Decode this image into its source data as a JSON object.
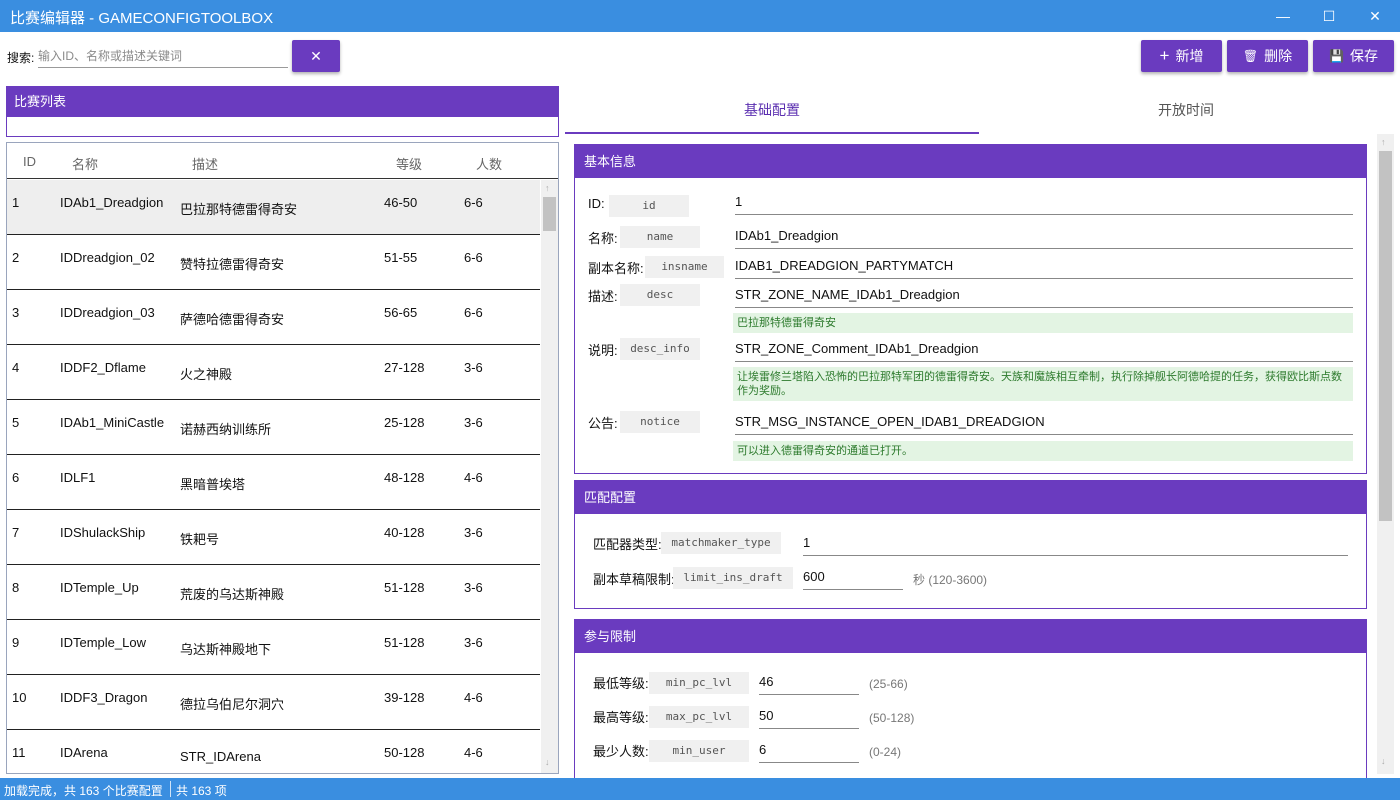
{
  "window": {
    "title": "比赛编辑器 - GAMECONFIGTOOLBOX",
    "minimize_icon": "minimize-icon",
    "maximize_icon": "maximize-icon",
    "close_icon": "close-icon",
    "minimize_glyph": "—",
    "maximize_glyph": "☐",
    "close_glyph": "✕"
  },
  "toolbar": {
    "search_label": "搜索:",
    "search_placeholder": "输入ID、名称或描述关键词",
    "search_value": "",
    "clear_glyph": "✕",
    "add_glyph": "+",
    "add_label": "新增",
    "delete_glyph": "🗑",
    "delete_label": "删除",
    "save_glyph": "💾",
    "save_label": "保存"
  },
  "list": {
    "header": "比赛列表",
    "columns": [
      "ID",
      "名称",
      "描述",
      "等级",
      "人数"
    ],
    "rows": [
      {
        "id": "1",
        "name": "IDAb1_Dreadgion",
        "desc": "巴拉那特德雷得奇安",
        "level": "46-50",
        "count": "6-6",
        "selected": true
      },
      {
        "id": "2",
        "name": "IDDreadgion_02",
        "desc": "赞特拉德雷得奇安",
        "level": "51-55",
        "count": "6-6"
      },
      {
        "id": "3",
        "name": "IDDreadgion_03",
        "desc": "萨德哈德雷得奇安",
        "level": "56-65",
        "count": "6-6"
      },
      {
        "id": "4",
        "name": "IDDF2_Dflame",
        "desc": "火之神殿",
        "level": "27-128",
        "count": "3-6"
      },
      {
        "id": "5",
        "name": "IDAb1_MiniCastle",
        "desc": "诺赫西纳训练所",
        "level": "25-128",
        "count": "3-6"
      },
      {
        "id": "6",
        "name": "IDLF1",
        "desc": "黑暗普埃塔",
        "level": "48-128",
        "count": "4-6"
      },
      {
        "id": "7",
        "name": "IDShulackShip",
        "desc": "铁耙号",
        "level": "40-128",
        "count": "3-6"
      },
      {
        "id": "8",
        "name": "IDTemple_Up",
        "desc": "荒废的乌达斯神殿",
        "level": "51-128",
        "count": "3-6"
      },
      {
        "id": "9",
        "name": "IDTemple_Low",
        "desc": "乌达斯神殿地下",
        "level": "51-128",
        "count": "3-6"
      },
      {
        "id": "10",
        "name": "IDDF3_Dragon",
        "desc": "德拉乌伯尼尔洞穴",
        "level": "39-128",
        "count": "4-6"
      },
      {
        "id": "11",
        "name": "IDArena",
        "desc": "STR_IDArena",
        "level": "50-128",
        "count": "4-6"
      }
    ]
  },
  "tabs": [
    {
      "label": "基础配置",
      "active": true
    },
    {
      "label": "开放时间",
      "active": false
    }
  ],
  "basic_info": {
    "header": "基本信息",
    "fields": [
      {
        "label": "ID:",
        "key": "id",
        "value": "1"
      },
      {
        "label": "名称:",
        "key": "name",
        "value": "IDAb1_Dreadgion"
      },
      {
        "label": "副本名称:",
        "key": "insname",
        "value": "IDAB1_DREADGION_PARTYMATCH"
      },
      {
        "label": "描述:",
        "key": "desc",
        "value": "STR_ZONE_NAME_IDAb1_Dreadgion",
        "note": "巴拉那特德雷得奇安"
      },
      {
        "label": "说明:",
        "key": "desc_info",
        "value": "STR_ZONE_Comment_IDAb1_Dreadgion",
        "note": "让埃雷修兰塔陷入恐怖的巴拉那特军团的德雷得奇安。天族和魔族相互牵制，执行除掉舰长阿德哈提的任务，获得欧比斯点数作为奖励。"
      },
      {
        "label": "公告:",
        "key": "notice",
        "value": "STR_MSG_INSTANCE_OPEN_IDAB1_DREADGION",
        "note": "可以进入德雷得奇安的通道已打开。"
      }
    ]
  },
  "match_config": {
    "header": "匹配配置",
    "fields": [
      {
        "label": "匹配器类型:",
        "key": "matchmaker_type",
        "value": "1",
        "hint": ""
      },
      {
        "label": "副本草稿限制:",
        "key": "limit_ins_draft",
        "value": "600",
        "hint": "秒 (120-3600)"
      }
    ]
  },
  "limits": {
    "header": "参与限制",
    "fields": [
      {
        "label": "最低等级:",
        "key": "min_pc_lvl",
        "value": "46",
        "hint": "(25-66)"
      },
      {
        "label": "最高等级:",
        "key": "max_pc_lvl",
        "value": "50",
        "hint": "(50-128)"
      },
      {
        "label": "最少人数:",
        "key": "min_user",
        "value": "6",
        "hint": "(0-24)"
      }
    ]
  },
  "status": {
    "text1": "加载完成，共 163 个比赛配置",
    "text2": "共 163 项"
  },
  "colors": {
    "accent": "#6a3bbf",
    "titlebar": "#3a8ee0",
    "note_bg": "#e3f4e3",
    "note_text": "#2c7a2c"
  }
}
